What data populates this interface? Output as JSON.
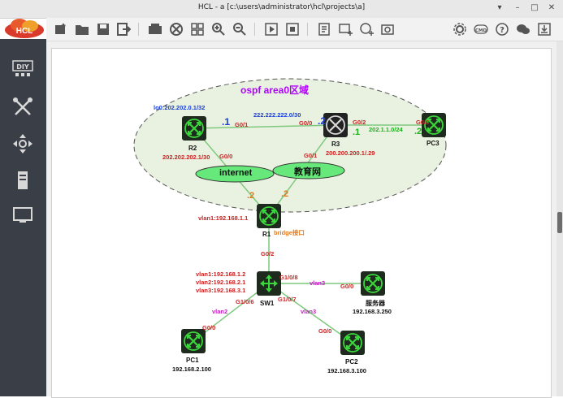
{
  "window": {
    "title": "HCL - a [c:\\users\\administrator\\hcl\\projects\\a]",
    "app_logo_text": "HCL"
  },
  "sidebar": {
    "items": [
      {
        "name": "diy-icon",
        "glyph": "DIY"
      },
      {
        "name": "tools-icon"
      },
      {
        "name": "move-icon"
      },
      {
        "name": "server-icon"
      },
      {
        "name": "monitor-icon"
      }
    ]
  },
  "topology": {
    "area_title": "ospf area0区域",
    "clouds": {
      "internet": "internet",
      "edu": "教育网"
    },
    "devices": {
      "r2": {
        "name": "R2",
        "lo": "lo0:202.202.0.1/32",
        "ip": "202.202.202.1/30"
      },
      "r3": {
        "name": "R3",
        "ip": "200.200.200.1/.29"
      },
      "pc3": {
        "name": "PC3"
      },
      "r1": {
        "name": "R1",
        "vlan": "vlan1:192.168.1.1",
        "bridge": "bridge接口"
      },
      "sw1": {
        "name": "SW1",
        "vlans": [
          "vlan1:192.168.1.2",
          "vlan2:192.168.2.1",
          "vlan3:192.168.3.1"
        ]
      },
      "server": {
        "name": "服务器",
        "ip": "192.168.3.250"
      },
      "pc1": {
        "name": "PC1",
        "ip": "192.168.2.100"
      },
      "pc2": {
        "name": "PC2",
        "ip": "192.168.3.100"
      }
    },
    "links": {
      "r2_r3_net": "222.222.222.0/30",
      "r3_pc3_net": "202.1.1.0/24"
    },
    "ports": {
      "r2_g01": "G0/1",
      "r2_g00": "G0/0",
      "r3_g00": "G0/0",
      "r3_g02": "G0/2",
      "r3_g01": "G0/1",
      "pc3_g00": "G0/0",
      "r1_g02": "G0/2",
      "sw1_g108": "G1/0/8",
      "sw1_g106": "G1/0/6",
      "sw1_g107": "G1/0/7",
      "server_g00": "G0/0",
      "pc1_g00": "G0/0",
      "pc2_g00": "G0/0",
      "vlan3_a": "vlan3",
      "vlan3_b": "vlan3",
      "vlan2": "vlan2"
    },
    "host_ids": {
      "r2": ".1",
      "r3_left": ".2",
      "r3_right": ".1",
      "pc3": ".2",
      "r1_left": ".2",
      "r1_right": ".2"
    }
  },
  "colors": {
    "router_fill": "#1d2a1d",
    "router_icon": "#3bd63b",
    "link": "#7fc97f",
    "cloud_fill": "#66e87a",
    "area_fill": "#e9f1e0",
    "port_label": "#cc2222",
    "net_label": "#1a3fd9",
    "vlan_label": "#c21fc2",
    "host_id": "#1a3fd9",
    "host_id_alt": "#e07a1f",
    "area_title": "#b000ff"
  }
}
